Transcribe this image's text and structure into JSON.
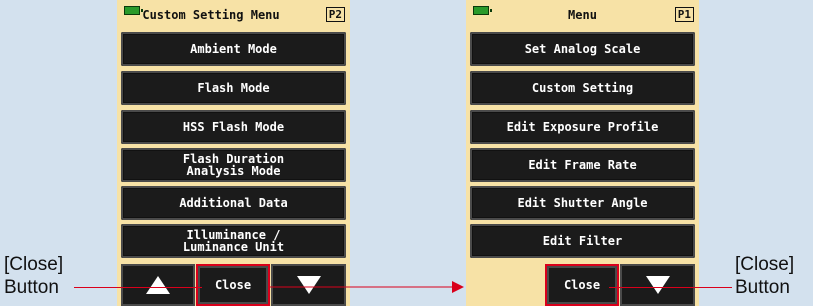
{
  "left_screen": {
    "title": "Custom Setting Menu",
    "page": "P2",
    "items": [
      {
        "label": "Ambient Mode"
      },
      {
        "label": "Flash Mode"
      },
      {
        "label": "HSS Flash Mode"
      },
      {
        "label": "Flash Duration\nAnalysis Mode"
      },
      {
        "label": "Additional Data"
      },
      {
        "label": "Illuminance /\nLuminance Unit"
      }
    ],
    "close_label": "Close",
    "up_icon": "triangle-up",
    "down_icon": "triangle-down"
  },
  "right_screen": {
    "title": "Menu",
    "page": "P1",
    "items": [
      {
        "label": "Set Analog Scale"
      },
      {
        "label": "Custom Setting"
      },
      {
        "label": "Edit Exposure Profile"
      },
      {
        "label": "Edit Frame Rate"
      },
      {
        "label": "Edit Shutter Angle"
      },
      {
        "label": "Edit Filter"
      }
    ],
    "close_label": "Close",
    "down_icon": "triangle-down"
  },
  "callouts": {
    "left": {
      "line1": "[Close]",
      "line2": "Button"
    },
    "right": {
      "line1": "[Close]",
      "line2": "Button"
    }
  },
  "colors": {
    "background": "#d3e1ee",
    "screen": "#f7e2a6",
    "button": "#1b1b1b",
    "accent": "#d9001b"
  }
}
